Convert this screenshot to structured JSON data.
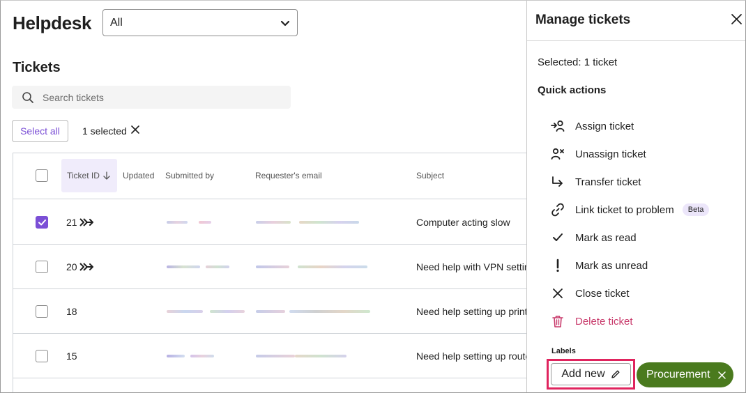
{
  "app": {
    "title": "Helpdesk",
    "view_filter": "All"
  },
  "tickets": {
    "title": "Tickets",
    "search_placeholder": "Search tickets",
    "select_all_label": "Select all",
    "selected_count": "1 selected",
    "columns": {
      "ticket_id": "Ticket ID",
      "updated": "Updated",
      "submitted_by": "Submitted by",
      "email": "Requester's email",
      "subject": "Subject"
    },
    "rows": [
      {
        "id": "21",
        "subject": "Computer acting slow",
        "checked": true,
        "forwarded": true
      },
      {
        "id": "20",
        "subject": "Need help with VPN setting",
        "checked": false,
        "forwarded": true
      },
      {
        "id": "18",
        "subject": "Need help setting up printer",
        "checked": false,
        "forwarded": false
      },
      {
        "id": "15",
        "subject": "Need help setting up router",
        "checked": false,
        "forwarded": false
      }
    ]
  },
  "panel": {
    "title": "Manage tickets",
    "selected": "Selected: 1 ticket",
    "quick_actions_title": "Quick actions",
    "actions": [
      {
        "label": "Assign ticket",
        "icon": "assign-icon"
      },
      {
        "label": "Unassign ticket",
        "icon": "unassign-icon"
      },
      {
        "label": "Transfer ticket",
        "icon": "transfer-icon"
      },
      {
        "label": "Link ticket to problem",
        "icon": "link-icon",
        "badge": "Beta"
      },
      {
        "label": "Mark as read",
        "icon": "checkmark-icon"
      },
      {
        "label": "Mark as unread",
        "icon": "exclamation-icon"
      },
      {
        "label": "Close ticket",
        "icon": "close-icon"
      },
      {
        "label": "Delete ticket",
        "icon": "trash-icon"
      }
    ],
    "labels_title": "Labels",
    "add_new_label": "Add new",
    "tag_label": "Procurement"
  },
  "colors": {
    "accent": "#7b4fd6",
    "danger": "#c83a6b",
    "tag_green": "#4a7a1e",
    "highlight": "#e0245e"
  }
}
